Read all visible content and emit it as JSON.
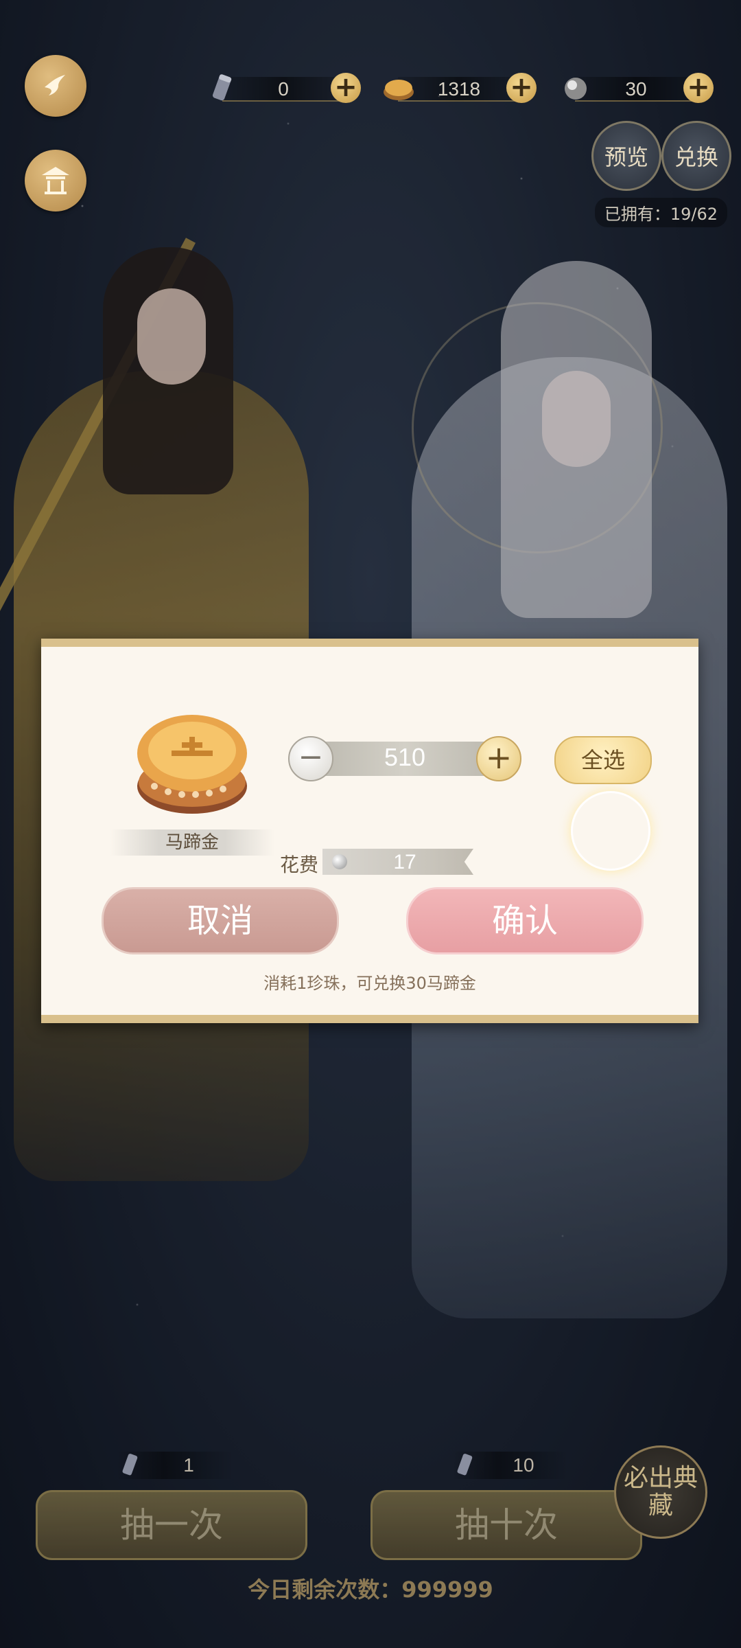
{
  "top_bar": {
    "back_icon": "bird-icon",
    "home_icon": "pavilion-icon",
    "resources": [
      {
        "icon": "scroll-icon",
        "value": "0"
      },
      {
        "icon": "horseshoe-gold-icon",
        "value": "1318"
      },
      {
        "icon": "pearl-icon",
        "value": "30"
      }
    ],
    "preview_label": "预览",
    "exchange_label": "兑换",
    "owned_text": "已拥有：19/62"
  },
  "modal": {
    "item_label": "马蹄金",
    "quantity": "510",
    "select_all_label": "全选",
    "cost_label": "花费",
    "cost_value": "17",
    "cancel_label": "取消",
    "confirm_label": "确认",
    "tip": "消耗1珍珠，可兑换30马蹄金"
  },
  "bottom": {
    "single_count": "1",
    "ten_count": "10",
    "draw_one_label": "抽一次",
    "draw_ten_label": "抽十次",
    "seal_text": "必出典藏",
    "remaining_text": "今日剩余次数：999999"
  },
  "colors": {
    "accent_gold": "#d9c08c",
    "confirm_pink": "#e79fa3",
    "cancel_rose": "#c99a92"
  }
}
